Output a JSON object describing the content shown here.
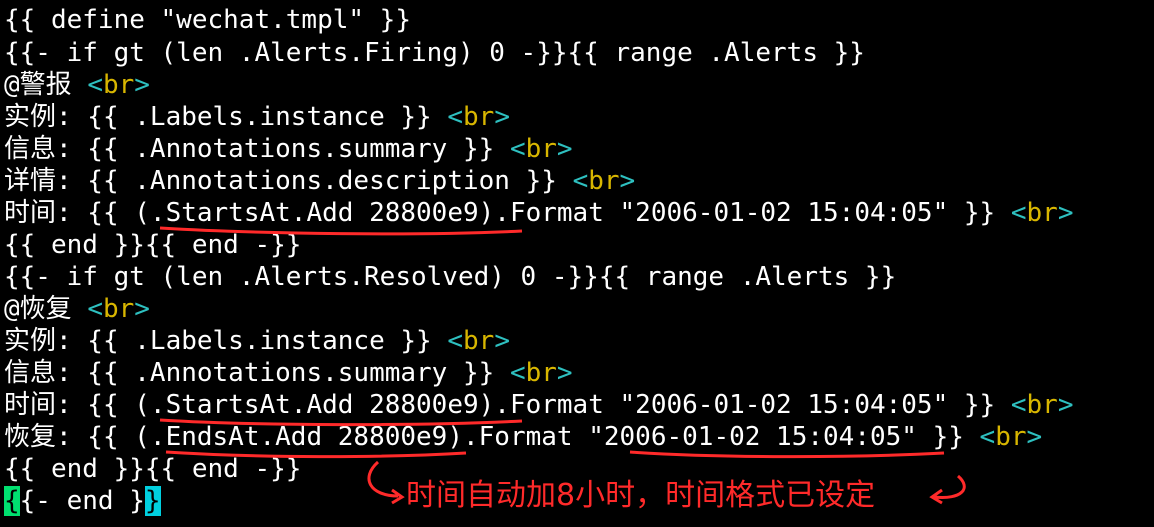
{
  "terminal": {
    "lines": [
      {
        "text": "{{ define \"wechat.tmpl\" }}"
      },
      {
        "text": "{{- if gt (len .Alerts.Firing) 0 -}}{{ range .Alerts }}"
      },
      {
        "text": "@警报 "
      },
      {
        "text": "实例: {{ .Labels.instance }} "
      },
      {
        "text": "信息: {{ .Annotations.summary }} "
      },
      {
        "text": "详情: {{ .Annotations.description }} "
      },
      {
        "text": "时间: {{ (.StartsAt.Add 28800e9).Format \"2006-01-02 15:04:05\" }} "
      },
      {
        "text": "{{ end }}{{ end -}}"
      },
      {
        "text": "{{- if gt (len .Alerts.Resolved) 0 -}}{{ range .Alerts }}"
      },
      {
        "text": "@恢复 "
      },
      {
        "text": "实例: {{ .Labels.instance }} "
      },
      {
        "text": "信息: {{ .Annotations.summary }} "
      },
      {
        "text": "时间: {{ (.StartsAt.Add 28800e9).Format \"2006-01-02 15:04:05\" }} "
      },
      {
        "text": "恢复: {{ (.EndsAt.Add 28800e9).Format \"2006-01-02 15:04:05\" }} "
      },
      {
        "text": "{{ end }}{{ end -}}"
      },
      {
        "text_cursor": "{",
        "text_mid": "{- end }",
        "text_end": "}"
      }
    ],
    "br_open": "<",
    "br_word": "br",
    "br_close": ">"
  },
  "annotation": {
    "note": "时间自动加8小时，时间格式已设定",
    "color": "#ff2a2a"
  },
  "colors": {
    "background": "#000000",
    "text": "#ffffff",
    "tag": "#2ec0c0",
    "tag_word": "#d8b600",
    "cursor": "#00e070"
  }
}
